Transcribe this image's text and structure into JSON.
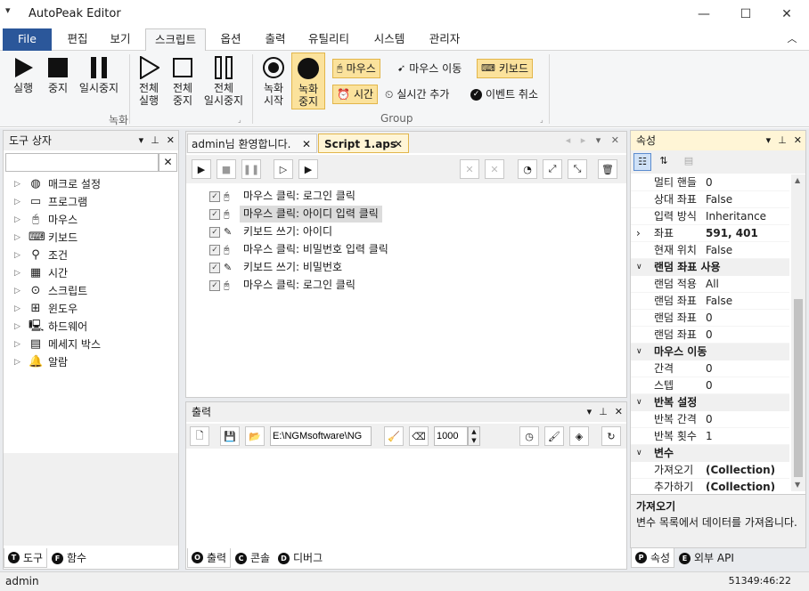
{
  "app": {
    "title": "AutoPeak Editor"
  },
  "menu": [
    "File",
    "편집",
    "보기",
    "스크립트",
    "옵션",
    "출력",
    "유틸리티",
    "시스템",
    "관리자"
  ],
  "ribbon": {
    "run": "실행",
    "stop": "중지",
    "pause": "일시중지",
    "run_all": "전체\n실행",
    "stop_all": "전체\n중지",
    "pause_all": "전체\n일시중지",
    "rec_start": "녹화\n시작",
    "rec_stop": "녹화\n중지",
    "mouse": "마우스",
    "mouse_move": "마우스 이동",
    "keyboard": "키보드",
    "time": "시간",
    "realtime_add": "실시간 추가",
    "event_cancel": "이벤트 취소",
    "group_rec": "녹화",
    "group_group": "Group"
  },
  "toolbox": {
    "title": "도구 상자",
    "search_value": "",
    "items": [
      "매크로 설정",
      "프로그램",
      "마우스",
      "키보드",
      "조건",
      "시간",
      "스크립트",
      "윈도우",
      "하드웨어",
      "메세지 박스",
      "알람"
    ],
    "tabs": [
      "도구",
      "함수"
    ]
  },
  "editor": {
    "tabs": [
      "admin님 환영합니다.",
      "Script 1.aps"
    ],
    "rows": [
      "마우스 클릭: 로그인 클릭",
      "마우스 클릭: 아이디 입력 클릭",
      "키보드 쓰기: 아이디",
      "마우스 클릭: 비밀번호 입력 클릭",
      "키보드 쓰기: 비밀번호",
      "마우스 클릭: 로그인 클릭"
    ]
  },
  "output": {
    "title": "출력",
    "path": "E:\\NGMsoftware\\NG",
    "number": "1000",
    "tabs": [
      "출력",
      "콘솔",
      "디버그"
    ]
  },
  "properties": {
    "title": "속성",
    "rows": [
      {
        "type": "row",
        "k": "멀티 핸들",
        "v": "0"
      },
      {
        "type": "row",
        "k": "상대 좌표",
        "v": "False"
      },
      {
        "type": "row",
        "k": "입력 방식",
        "v": "Inheritance"
      },
      {
        "type": "row",
        "k": "좌표",
        "v": "591, 401",
        "bold": true,
        "expander": "›"
      },
      {
        "type": "row",
        "k": "현재 위치",
        "v": "False"
      },
      {
        "type": "cat",
        "k": "랜덤 좌표 사용"
      },
      {
        "type": "row",
        "k": "랜덤 적용",
        "v": "All"
      },
      {
        "type": "row",
        "k": "랜덤 좌표",
        "v": "False"
      },
      {
        "type": "row",
        "k": "랜덤 좌표",
        "v": "0"
      },
      {
        "type": "row",
        "k": "랜덤 좌표",
        "v": "0"
      },
      {
        "type": "cat",
        "k": "마우스 이동"
      },
      {
        "type": "row",
        "k": "간격",
        "v": "0"
      },
      {
        "type": "row",
        "k": "스텝",
        "v": "0"
      },
      {
        "type": "cat",
        "k": "반복 설정"
      },
      {
        "type": "row",
        "k": "반복 간격",
        "v": "0"
      },
      {
        "type": "row",
        "k": "반복 횟수",
        "v": "1"
      },
      {
        "type": "cat",
        "k": "변수"
      },
      {
        "type": "row",
        "k": "가져오기",
        "v": "(Collection)",
        "bold": true
      },
      {
        "type": "row",
        "k": "추가하기",
        "v": "(Collection)",
        "bold": true
      }
    ],
    "desc_title": "가져오기",
    "desc_text": "변수 목록에서 데이터를 가져옵니다.",
    "tabs": [
      "속성",
      "외부 API"
    ]
  },
  "status": {
    "user": "admin",
    "clock": "51349:46:22"
  },
  "colors": {
    "accent": "#2b579a",
    "highlight": "#fbe29c",
    "record": "#f9c84a",
    "title_active": "#fff5d6"
  }
}
